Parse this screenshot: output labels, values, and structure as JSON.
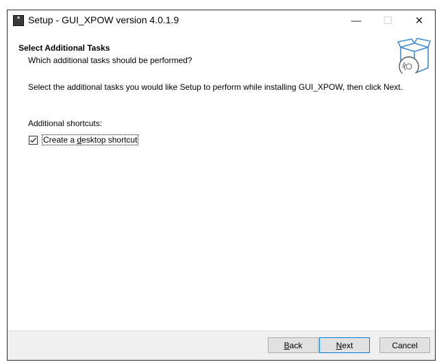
{
  "window": {
    "title": "Setup - GUI_XPOW version 4.0.1.9",
    "controls": {
      "minimize": "—",
      "maximize": "☐",
      "close": "✕"
    }
  },
  "header": {
    "title": "Select Additional Tasks",
    "subtitle": "Which additional tasks should be performed?",
    "graphic_icon": "setup-box-disc-icon"
  },
  "content": {
    "description": "Select the additional tasks you would like Setup to perform while installing GUI_XPOW, then click Next.",
    "group_label": "Additional shortcuts:",
    "tasks": [
      {
        "label_prefix": "Create a ",
        "label_hotkey": "d",
        "label_suffix": "esktop shortcut",
        "checked": true
      }
    ]
  },
  "footer": {
    "back": {
      "hotkey": "B",
      "rest": "ack"
    },
    "next": {
      "hotkey": "N",
      "rest": "ext"
    },
    "cancel": "Cancel"
  },
  "colors": {
    "accent": "#0078d7",
    "footer_bg": "#f0f0f0",
    "button_bg": "#e1e1e1"
  }
}
